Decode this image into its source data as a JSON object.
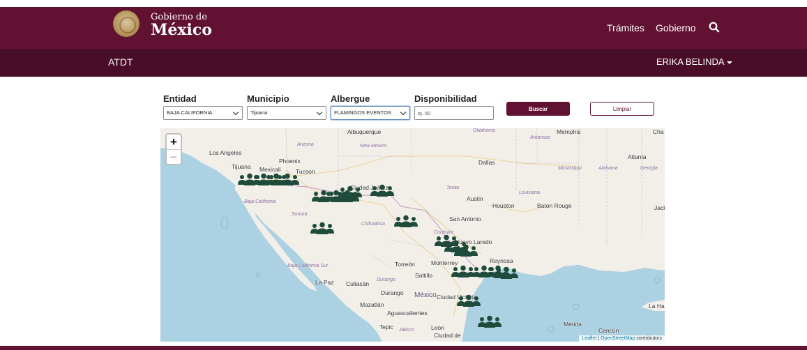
{
  "header": {
    "logo_line1": "Gobierno de",
    "logo_line2": "México",
    "nav": [
      "Trámites",
      "Gobierno"
    ],
    "search_icon": "search-icon"
  },
  "subheader": {
    "title": "ATDT",
    "user": "ERIKA BELINDA"
  },
  "filters": {
    "entidad": {
      "label": "Entidad",
      "value": "BAJA CALIFORNIA"
    },
    "municipio": {
      "label": "Municipio",
      "value": "Tijuana"
    },
    "albergue": {
      "label": "Albergue",
      "value": "FLAMINGOS EVENTOS"
    },
    "disponibilidad": {
      "label": "Disponibilidad",
      "placeholder": "ej. 50"
    },
    "buscar": "Buscar",
    "limpiar": "Limpiar"
  },
  "map": {
    "zoom_in": "+",
    "zoom_out": "−",
    "attribution_leaflet": "Leaflet",
    "attribution_sep": " | ",
    "attribution_osm": "OpenStreetMap",
    "attribution_suffix": " contributors",
    "marker_icon": "people-group-icon",
    "marker_color": "#1e4b3b",
    "cities": [
      "Los Angeles",
      "Tijuana",
      "Mexicali",
      "Phoenix",
      "Tucson",
      "Albuquerque",
      "Ciudad Juárez",
      "Dallas",
      "Austin",
      "Houston",
      "San Antonio",
      "Baton Rouge",
      "Atlanta",
      "Memphis",
      "Nuevo Laredo",
      "Reynosa",
      "Monterrey",
      "Saltillo",
      "Torreón",
      "La Paz",
      "Culiacán",
      "Durango",
      "Mazatlán",
      "Aguascalientes",
      "Tepic",
      "León",
      "Ciudad Victoria",
      "Mérida",
      "Cancún",
      "La Habana",
      "Ciudad de",
      "Jack",
      "Cha"
    ],
    "regions": [
      "Arizona",
      "New Mexico",
      "Oklahoma",
      "Arkansas",
      "Texas",
      "Louisiana",
      "Mississippi",
      "Alabama",
      "Georgia",
      "Baja California",
      "Sonora",
      "Chihuahua",
      "Coahuila",
      "Baja California Sur",
      "Durango",
      "Jalisco",
      "México"
    ]
  }
}
